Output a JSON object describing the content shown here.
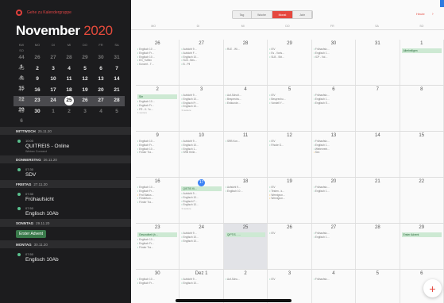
{
  "sidebar": {
    "top_label": "Gehe zu Kalendergruppe",
    "month": "November",
    "year": "2020",
    "weekday_heads": [
      "KW",
      "MO",
      "DI",
      "MI",
      "DO",
      "FR",
      "SA",
      "SO"
    ],
    "weeks": [
      [
        "44",
        "26",
        "27",
        "28",
        "29",
        "30",
        "31",
        "1"
      ],
      [
        "45",
        "2",
        "3",
        "4",
        "5",
        "6",
        "7",
        "8"
      ],
      [
        "46",
        "9",
        "10",
        "11",
        "12",
        "13",
        "14",
        "15"
      ],
      [
        "47",
        "16",
        "17",
        "18",
        "19",
        "20",
        "21",
        "22"
      ],
      [
        "48",
        "23",
        "24",
        "25",
        "26",
        "27",
        "28",
        "29"
      ],
      [
        "49",
        "30",
        "1",
        "2",
        "3",
        "4",
        "5",
        "6"
      ]
    ]
  },
  "agenda": [
    {
      "head": "MITTWOCH",
      "date": "25.11.20",
      "events": [
        {
          "time": "10:00",
          "name": "QUITREIS - Online",
          "sub": "Webex Connect"
        }
      ]
    },
    {
      "head": "DONNERSTAG",
      "date": "26.11.20",
      "events": [
        {
          "time": "07:30",
          "name": "SDV",
          "sub": ""
        }
      ]
    },
    {
      "head": "FREITAG",
      "date": "27.11.20",
      "events": [
        {
          "time": "07:30",
          "name": "Frühaufsicht",
          "sub": ""
        },
        {
          "time": "07:50",
          "name": "Englisch 10Ab",
          "sub": ""
        }
      ]
    },
    {
      "head": "SONNTAG",
      "date": "29.11.20",
      "allday": "Erster Advent",
      "events": []
    },
    {
      "head": "MONTAG",
      "date": "30.11.20",
      "events": [
        {
          "time": "07:50",
          "name": "Englisch 10Ab",
          "sub": ""
        }
      ]
    }
  ],
  "main": {
    "segments": [
      "Tag",
      "Woche",
      "Monat",
      "Jahr"
    ],
    "active_segment": "Monat",
    "today_label": "Heute",
    "today_arrow": "›",
    "weekdays": [
      "MO",
      "DI",
      "MI",
      "DO",
      "FR",
      "SA",
      "SO"
    ],
    "weeks": [
      {
        "days": [
          {
            "n": "26",
            "ev": [
              "Englisch 10 …",
              "Englisch Fr…",
              "Englisch 10…",
              "EG_Tutflex",
              "Konzert - T…"
            ]
          },
          {
            "n": "27",
            "ev": [
              "Aufsicht 9…",
              "Aufsicht F…",
              "Englisch 10…",
              "SLB - Bes…",
              "B - Pfl"
            ]
          },
          {
            "n": "28",
            "ev": [
              "RLE - Wi…"
            ]
          },
          {
            "n": "29",
            "ev": [
              "ISV",
              "Es - Voris…",
              "SLB - Stit…"
            ]
          },
          {
            "n": "30",
            "ev": [
              "Frühaufsic…",
              "Englisch 1…",
              "ICP - Vol…"
            ]
          },
          {
            "n": "31",
            "ev": []
          },
          {
            "n": "1",
            "ev": [],
            "bar": "Allerheiligen"
          }
        ]
      },
      {
        "days": [
          {
            "n": "2",
            "bar": "Sbr",
            "ev": [
              "Englisch 10…",
              "Englisch Fr…",
              "FR - K. Yo…",
              "1 weitere"
            ]
          },
          {
            "n": "3",
            "ev": [
              "Aufsicht 9…",
              "Englisch 10…",
              "Englisch Fr…",
              "Englisch 10…",
              "3 weitere"
            ]
          },
          {
            "n": "4",
            "ev": [
              "Auf-Schult…",
              "Besprechu…",
              "Erdkunde…"
            ]
          },
          {
            "n": "5",
            "ev": [
              "ISV",
              "Besprechu…",
              "Vorstell Y…"
            ]
          },
          {
            "n": "6",
            "ev": [
              "Frühaufsic…",
              "Englisch 1…",
              "Englisch E…"
            ]
          },
          {
            "n": "7",
            "ev": []
          },
          {
            "n": "8",
            "ev": []
          }
        ]
      },
      {
        "days": [
          {
            "n": "9",
            "ev": [
              "Englisch 10…",
              "Englisch Fr…",
              "Englisch 10…",
              "Förder Tra…"
            ]
          },
          {
            "n": "10",
            "ev": [
              "Aufsicht 9…",
              "Englisch 10…",
              "Englisch 1…",
              "SRB Helle…"
            ]
          },
          {
            "n": "11",
            "ev": [
              "SRB Kon…"
            ]
          },
          {
            "n": "12",
            "ev": [
              "ISV",
              "Rhode G…"
            ]
          },
          {
            "n": "13",
            "ev": [
              "Frühaufsic…",
              "Englisch 1…",
              "Weiterverb…",
              "Sex"
            ]
          },
          {
            "n": "14",
            "ev": []
          },
          {
            "n": "15",
            "ev": []
          }
        ]
      },
      {
        "days": [
          {
            "n": "16",
            "ev": [
              "Englisch 10…",
              "Englisch Fr…",
              "Fed Status…",
              "Förderkon…",
              "Förder Tra…"
            ]
          },
          {
            "n": "17",
            "today": true,
            "bar": "QISTIS Ki…",
            "ev": [
              "Aufsicht 9…",
              "Englisch 10…",
              "Englisch F…",
              "Englisch 10…",
              "3 weitere"
            ]
          },
          {
            "n": "18",
            "ev": [
              "Aufsicht 9…",
              "Englisch 10…"
            ]
          },
          {
            "n": "19",
            "ev": [
              "ISV",
              "Testen - k…",
              "Wernigrun…",
              "Wernigrun…"
            ]
          },
          {
            "n": "20",
            "ev": [
              "Frühaufsic…",
              "Englisch 1…"
            ]
          },
          {
            "n": "21",
            "ev": []
          },
          {
            "n": "22",
            "ev": []
          }
        ]
      },
      {
        "days": [
          {
            "n": "23",
            "bar": "Gesundheit (h…",
            "ev": [
              "Englisch 10…",
              "Englisch Fr…",
              "Förder Tra…"
            ]
          },
          {
            "n": "24",
            "ev": [
              "Aufsicht 9…",
              "Englisch 10…",
              "Englisch 10…"
            ]
          },
          {
            "n": "25",
            "dim": true,
            "bar": "QIPTIS - …",
            "ev": []
          },
          {
            "n": "26",
            "ev": [
              "ISV"
            ]
          },
          {
            "n": "27",
            "ev": [
              "Frühaufsic…",
              "Englisch 1…"
            ]
          },
          {
            "n": "28",
            "ev": []
          },
          {
            "n": "29",
            "ev": [],
            "bar": "Erster Advent"
          }
        ]
      },
      {
        "days": [
          {
            "n": "30",
            "ev": [
              "Englisch 10…",
              "Englisch Fr…"
            ]
          },
          {
            "n": "Dez 1",
            "ev": [
              "Aufsicht 9…",
              "Englisch 10…"
            ]
          },
          {
            "n": "2",
            "ev": [
              "Auf-Schu…"
            ]
          },
          {
            "n": "3",
            "ev": [
              "ISV"
            ]
          },
          {
            "n": "4",
            "ev": [
              "Frühaufsic…"
            ]
          },
          {
            "n": "5",
            "ev": []
          },
          {
            "n": "6",
            "ev": []
          }
        ]
      }
    ]
  },
  "fab": "+"
}
